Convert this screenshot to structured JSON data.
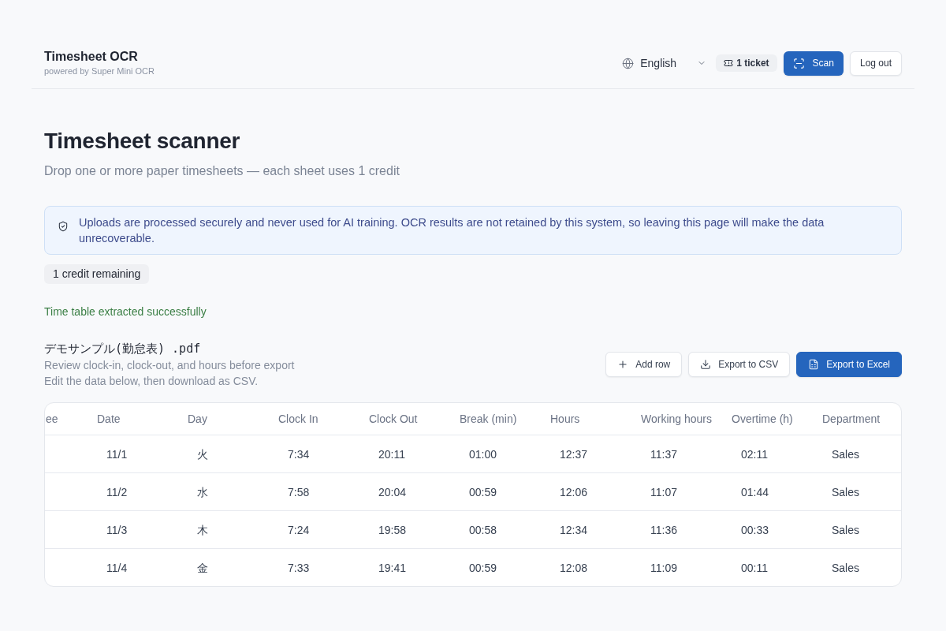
{
  "header": {
    "title": "Timesheet OCR",
    "subtitle": "powered by Super Mini OCR",
    "language": "English",
    "tickets": "1 ticket",
    "scan_button": "Scan",
    "logout_button": "Log out"
  },
  "page": {
    "title": "Timesheet scanner",
    "subtitle": "Drop one or more paper timesheets — each sheet uses 1 credit"
  },
  "notice": "Uploads are processed securely and never used for AI training. OCR results are not retained by this system, so leaving this page will make the data unrecoverable.",
  "credits_badge": "1 credit remaining",
  "status_message": "Time table extracted successfully",
  "file": {
    "name": "デモサンプル(勤怠表) .pdf",
    "description": [
      "Review clock-in, clock-out, and hours before export",
      "Edit the data below, then download as CSV."
    ]
  },
  "actions": [
    {
      "kind": "add",
      "label": "Add row"
    },
    {
      "kind": "csv",
      "label": "Export to CSV"
    },
    {
      "kind": "excel",
      "label": "Export to Excel"
    }
  ],
  "table": {
    "columns": [
      "ee",
      "Date",
      "Day",
      "Clock In",
      "Clock Out",
      "Break (min)",
      "Hours",
      "Working hours",
      "Overtime (h)",
      "Department"
    ],
    "rows": [
      [
        "",
        "11/1",
        "火",
        "7:34",
        "20:11",
        "01:00",
        "12:37",
        "11:37",
        "02:11",
        "Sales"
      ],
      [
        "",
        "11/2",
        "水",
        "7:58",
        "20:04",
        "00:59",
        "12:06",
        "11:07",
        "01:44",
        "Sales"
      ],
      [
        "",
        "11/3",
        "木",
        "7:24",
        "19:58",
        "00:58",
        "12:34",
        "11:36",
        "00:33",
        "Sales"
      ],
      [
        "",
        "11/4",
        "金",
        "7:33",
        "19:41",
        "00:59",
        "12:08",
        "11:09",
        "00:11",
        "Sales"
      ]
    ]
  }
}
